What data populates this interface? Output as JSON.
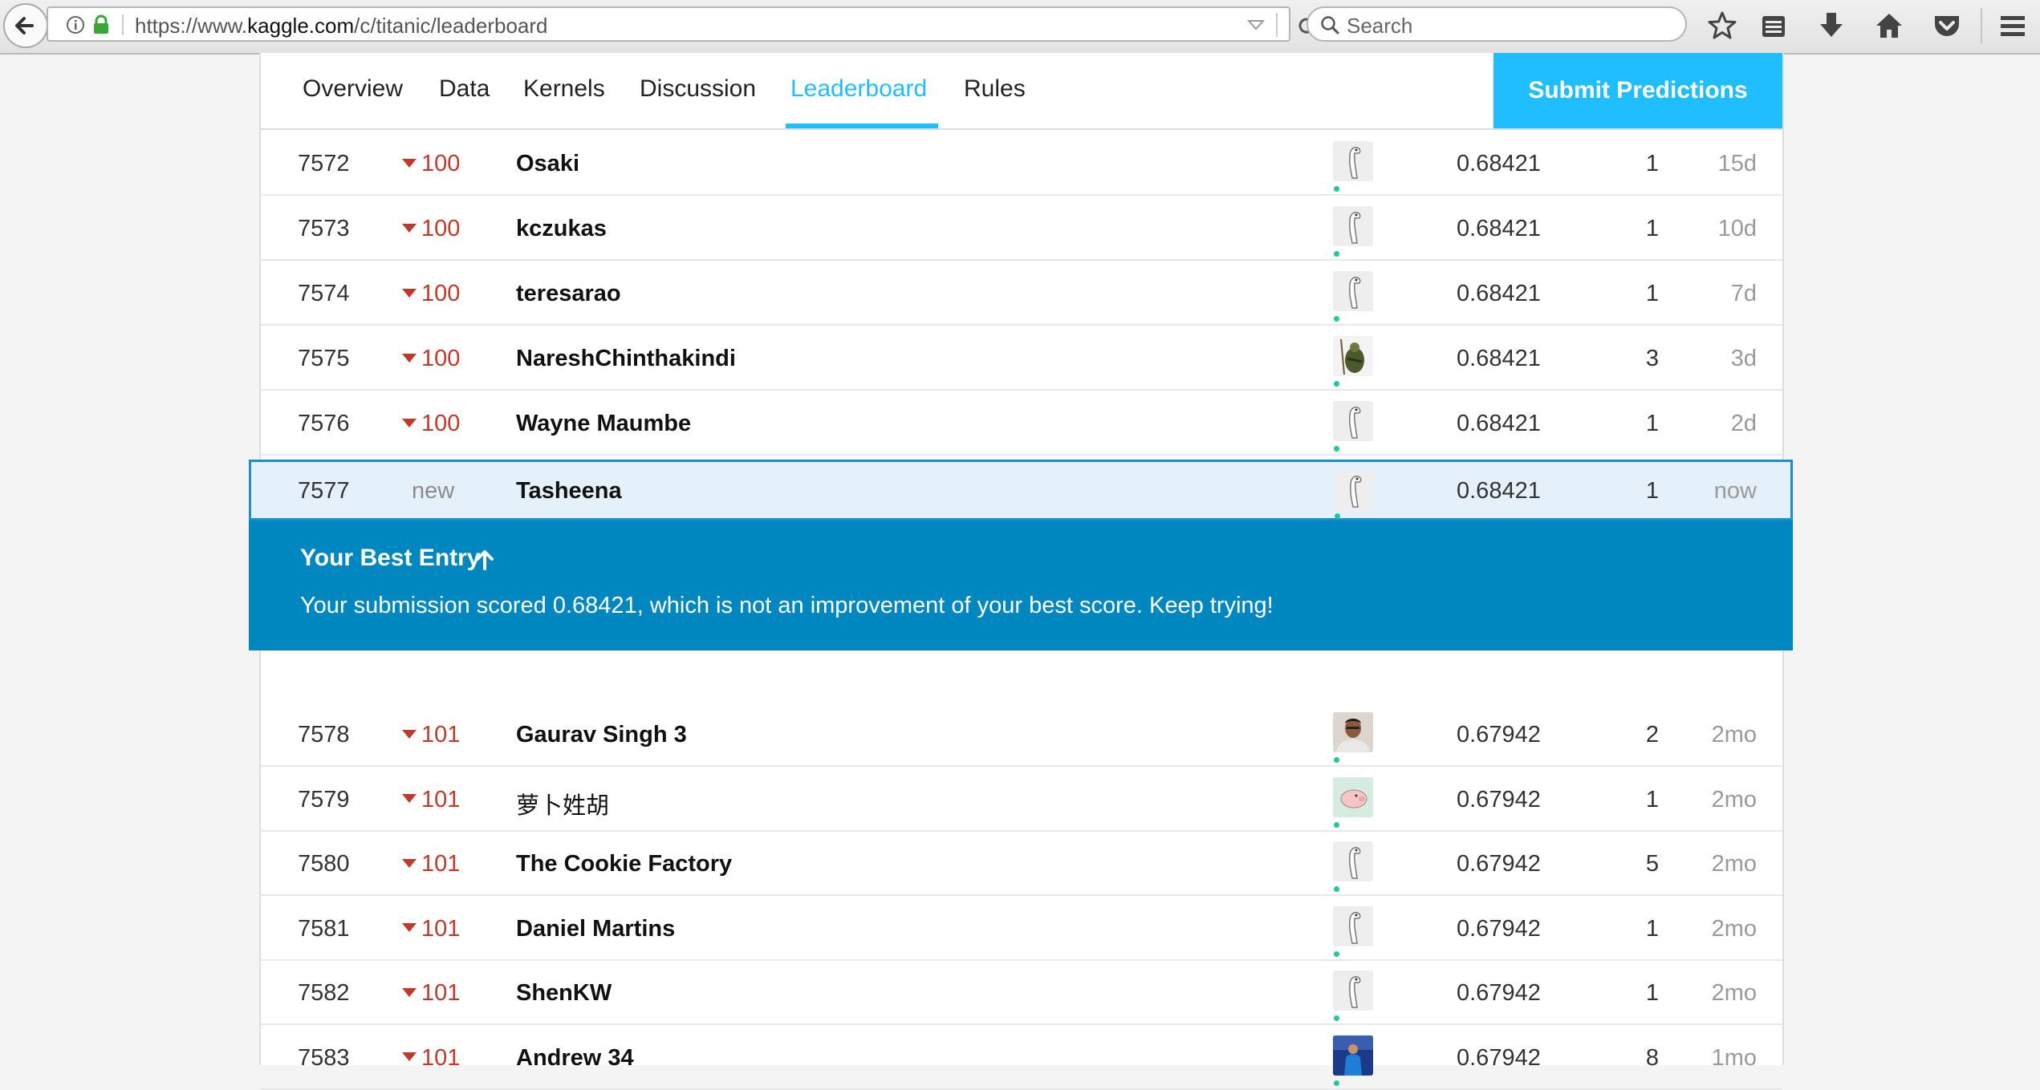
{
  "browser": {
    "url": "https://www.kaggle.com/c/titanic/leaderboard",
    "search_placeholder": "Search"
  },
  "nav": {
    "tabs": [
      {
        "label": "Overview"
      },
      {
        "label": "Data"
      },
      {
        "label": "Kernels"
      },
      {
        "label": "Discussion"
      },
      {
        "label": "Leaderboard",
        "active": true
      },
      {
        "label": "Rules"
      }
    ],
    "submit_label": "Submit Predictions"
  },
  "rows_above": [
    {
      "rank": "7572",
      "change": "100",
      "name": "Osaki",
      "avatar": "ostrich-avatar",
      "score": "0.68421",
      "entries": "1",
      "last": "15d"
    },
    {
      "rank": "7573",
      "change": "100",
      "name": "kczukas",
      "avatar": "ostrich-avatar",
      "score": "0.68421",
      "entries": "1",
      "last": "10d"
    },
    {
      "rank": "7574",
      "change": "100",
      "name": "teresarao",
      "avatar": "ostrich-avatar",
      "score": "0.68421",
      "entries": "1",
      "last": "7d"
    },
    {
      "rank": "7575",
      "change": "100",
      "name": "NareshChinthakindi",
      "avatar": "warrior-avatar",
      "score": "0.68421",
      "entries": "3",
      "last": "3d"
    },
    {
      "rank": "7576",
      "change": "100",
      "name": "Wayne Maumbe",
      "avatar": "ostrich-avatar",
      "score": "0.68421",
      "entries": "1",
      "last": "2d"
    }
  ],
  "highlight": {
    "rank": "7577",
    "change": "new",
    "name": "Tasheena",
    "avatar": "ostrich-avatar",
    "score": "0.68421",
    "entries": "1",
    "last": "now"
  },
  "best_entry": {
    "title": "Your Best Entry",
    "message": "Your submission scored 0.68421, which is not an improvement of your best score. Keep trying!"
  },
  "rows_below": [
    {
      "rank": "7578",
      "change": "101",
      "name": "Gaurav Singh 3",
      "avatar": "photo-avatar",
      "score": "0.67942",
      "entries": "2",
      "last": "2mo"
    },
    {
      "rank": "7579",
      "change": "101",
      "name": "萝卜姓胡",
      "avatar": "pig-avatar",
      "score": "0.67942",
      "entries": "1",
      "last": "2mo"
    },
    {
      "rank": "7580",
      "change": "101",
      "name": "The Cookie Factory",
      "avatar": "ostrich-avatar",
      "score": "0.67942",
      "entries": "5",
      "last": "2mo"
    },
    {
      "rank": "7581",
      "change": "101",
      "name": "Daniel Martins",
      "avatar": "ostrich-avatar",
      "score": "0.67942",
      "entries": "1",
      "last": "2mo"
    },
    {
      "rank": "7582",
      "change": "101",
      "name": "ShenKW",
      "avatar": "ostrich-avatar",
      "score": "0.67942",
      "entries": "1",
      "last": "2mo"
    },
    {
      "rank": "7583",
      "change": "101",
      "name": "Andrew 34",
      "avatar": "photo-avatar-blue",
      "score": "0.67942",
      "entries": "8",
      "last": "1mo"
    }
  ],
  "colors": {
    "accent": "#20beff",
    "best_entry_bg": "#0087c0",
    "highlight_bg": "#e4f1fa",
    "rank_down": "#c0392b"
  }
}
